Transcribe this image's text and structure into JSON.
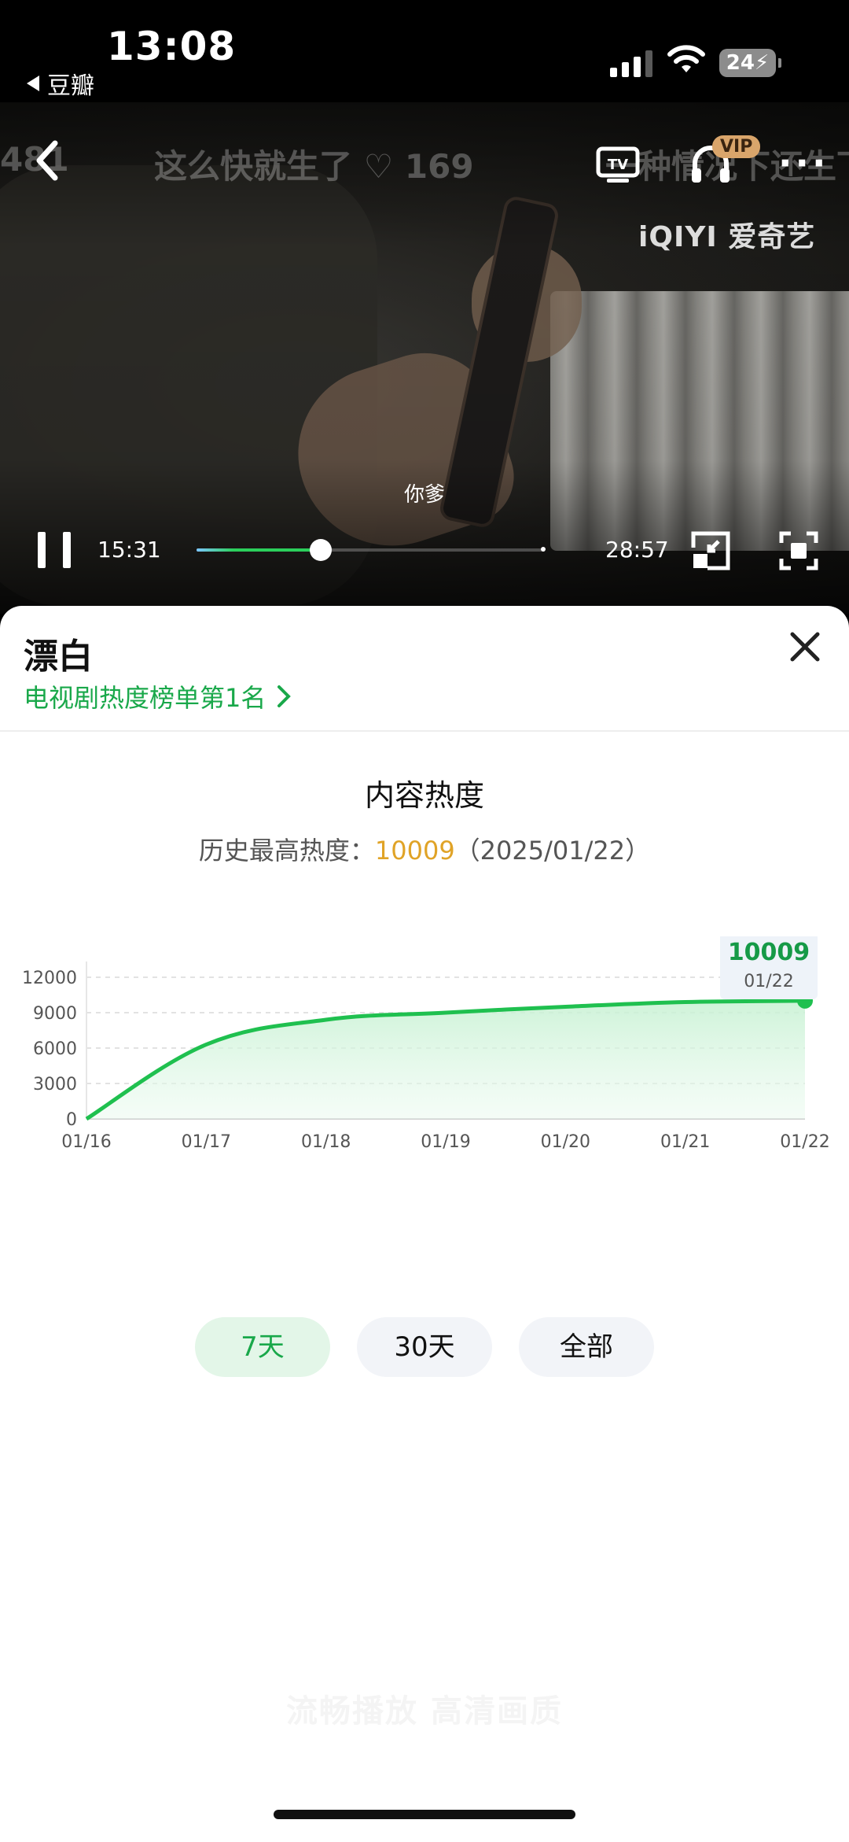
{
  "status_bar": {
    "time": "13:08",
    "back_app": "豆瓣",
    "battery": "24"
  },
  "video": {
    "danmaku": [
      "481",
      "这么快就生了 ♡ 169",
      "一种情况下还生下"
    ],
    "vip_badge": "VIP",
    "watermark": "iQIYI 爱奇艺",
    "subtitle": "你爹",
    "current_time": "15:31",
    "total_time": "28:57",
    "progress": 0.36
  },
  "sheet": {
    "title": "漂白",
    "rank_text": "电视剧热度榜单第1名",
    "heat_title": "内容热度",
    "heat_sub_label": "历史最高热度：",
    "heat_sub_value": "10009",
    "heat_sub_date": "（2025/01/22）",
    "range_tabs": [
      {
        "label": "7天",
        "active": true
      },
      {
        "label": "30天",
        "active": false
      },
      {
        "label": "全部",
        "active": false
      }
    ],
    "faint_text": "流畅播放 高清画质"
  },
  "chart_data": {
    "type": "area",
    "categories": [
      "01/16",
      "01/17",
      "01/18",
      "01/19",
      "01/20",
      "01/21",
      "01/22"
    ],
    "values": [
      0,
      6300,
      8400,
      9000,
      9500,
      9900,
      10009
    ],
    "ylim": [
      0,
      12000
    ],
    "yticks": [
      "0",
      "3000",
      "6000",
      "9000",
      "12000"
    ],
    "grid": true,
    "highlight": {
      "value": "10009",
      "date": "01/22"
    },
    "colors": {
      "line": "#1fc04f",
      "highlight_value": "#169a47",
      "tooltip_bg": "#eef3f9"
    }
  }
}
